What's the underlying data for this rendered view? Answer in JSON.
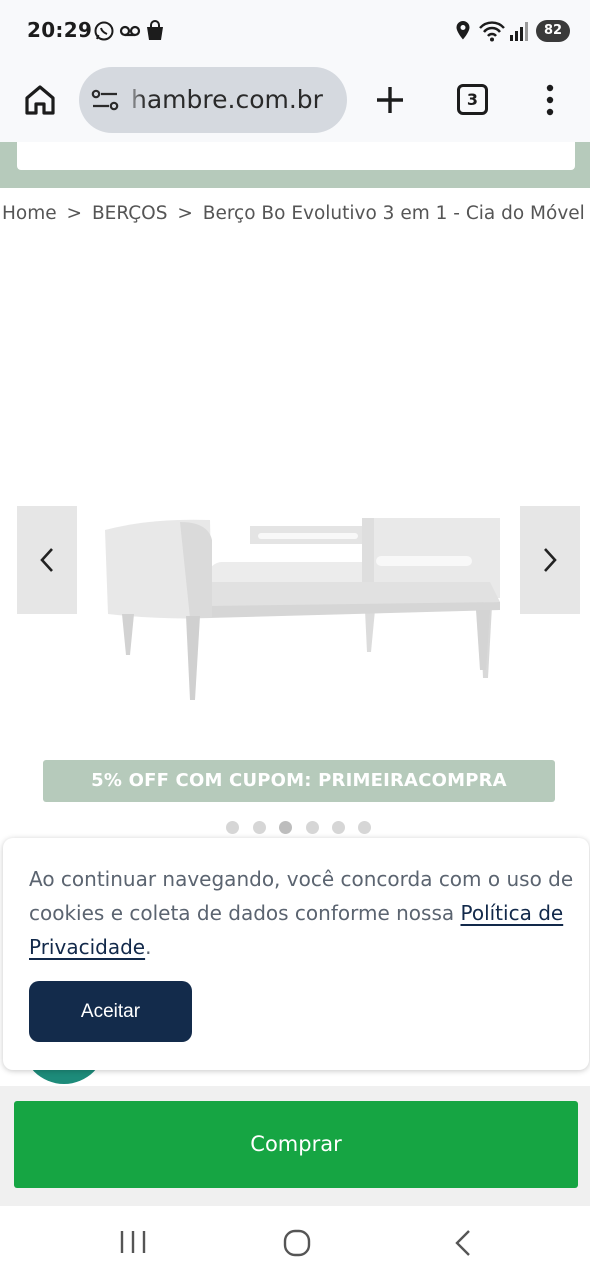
{
  "status_bar": {
    "time": "20:29",
    "battery": "82",
    "icons": [
      "whatsapp-icon",
      "voicemail-icon",
      "shopping-bag-icon",
      "location-icon",
      "wifi-icon",
      "signal-icon"
    ]
  },
  "browser": {
    "url": "hambre.com.br",
    "tab_count": "3",
    "icons": [
      "home-icon",
      "site-settings-icon",
      "new-tab-icon",
      "more-menu-icon"
    ]
  },
  "breadcrumb": {
    "home": "Home",
    "sep1": ">",
    "category": "BERÇOS",
    "sep2": ">",
    "current": "Berço Bo Evolutivo 3 em 1 - Cia do Móvel"
  },
  "gallery": {
    "image_count": 6,
    "active_index": 2,
    "icons": [
      "chevron-left-icon",
      "chevron-right-icon"
    ]
  },
  "promo": {
    "text": "5% OFF COM CUPOM: PRIMEIRACOMPRA"
  },
  "cookie_banner": {
    "text": "Ao continuar navegando, você concorda com o uso de cookies e coleta de dados conforme nossa ",
    "link_text": "Política de Privacidade",
    "suffix": ".",
    "accept_label": "Aceitar"
  },
  "buy": {
    "label": "Comprar"
  },
  "nav_bar": {
    "icons": [
      "recent-apps-icon",
      "home-circle-icon",
      "back-icon"
    ]
  },
  "colors": {
    "accent_green": "#16a543",
    "promo_green": "#b6cabb",
    "navy": "#132b4b",
    "teal": "#1d8b7a"
  }
}
